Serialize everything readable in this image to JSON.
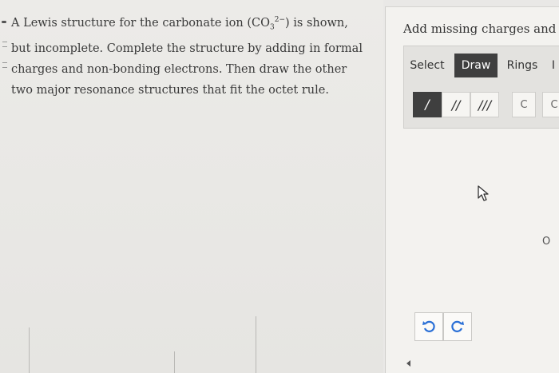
{
  "question": {
    "prefix": "A Lewis structure for the carbonate ion (CO",
    "sub": "3",
    "sup": "2−",
    "suffix": ") is shown, but incomplete. Complete the structure by adding in formal charges and non-bonding electrons. Then draw the other two major resonance structures that fit the octet rule."
  },
  "panel": {
    "title": "Add missing charges and n",
    "tools": {
      "select": "Select",
      "draw": "Draw",
      "rings": "Rings",
      "more": "I"
    },
    "bonds": {
      "single": "/",
      "double": "//",
      "triple": "///"
    },
    "atoms": {
      "carbon": "C",
      "oxygen": "C"
    },
    "canvas_atom": "O",
    "icons": {
      "cursor": "pointer-arrow-icon",
      "undo": "undo-icon",
      "redo": "redo-icon"
    },
    "colors": {
      "active_tool": "#3f3f3f",
      "history_icon": "#2a6fd6"
    }
  }
}
